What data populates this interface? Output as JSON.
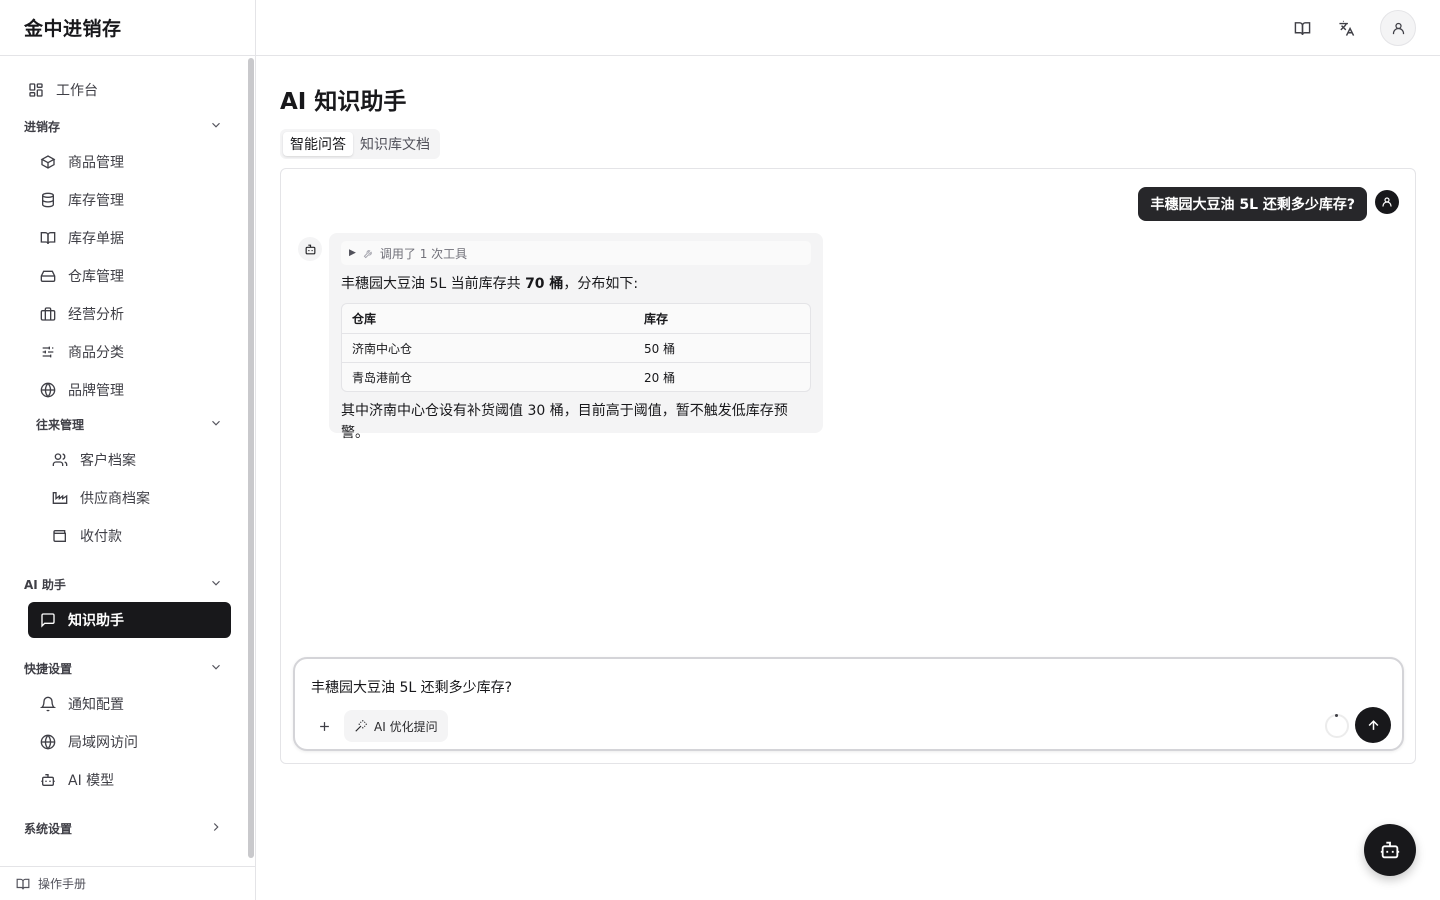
{
  "app": {
    "title": "金中进销存"
  },
  "sidebar": {
    "workbench": "工作台",
    "groups": {
      "jxc": "进销存",
      "partners": "往来管理",
      "ai": "AI 助手",
      "quick": "快捷设置",
      "system": "系统设置"
    },
    "jxc_items": [
      {
        "label": "商品管理",
        "icon": "box-icon"
      },
      {
        "label": "库存管理",
        "icon": "database-icon"
      },
      {
        "label": "库存单据",
        "icon": "book-open-icon"
      },
      {
        "label": "仓库管理",
        "icon": "warehouse-icon"
      },
      {
        "label": "经营分析",
        "icon": "briefcase-icon"
      },
      {
        "label": "商品分类",
        "icon": "sliders-icon"
      },
      {
        "label": "品牌管理",
        "icon": "globe-icon"
      }
    ],
    "partner_items": [
      {
        "label": "客户档案",
        "icon": "users-icon"
      },
      {
        "label": "供应商档案",
        "icon": "factory-icon"
      },
      {
        "label": "收付款",
        "icon": "wallet-icon"
      }
    ],
    "ai_items": [
      {
        "label": "知识助手",
        "icon": "message-square-icon",
        "active": true
      }
    ],
    "quick_items": [
      {
        "label": "通知配置",
        "icon": "bell-icon"
      },
      {
        "label": "局域网访问",
        "icon": "globe-icon"
      },
      {
        "label": "AI 模型",
        "icon": "bot-icon"
      }
    ],
    "footer": "操作手册"
  },
  "topbar": {
    "icons": [
      "book-open-icon",
      "languages-icon",
      "user-icon"
    ]
  },
  "main": {
    "title": "AI 知识助手",
    "tabs": [
      {
        "label": "智能问答",
        "active": true
      },
      {
        "label": "知识库文档",
        "active": false
      }
    ],
    "chat": {
      "user_message": "丰穗园大豆油 5L 还剩多少库存?",
      "tool_call": "调用了 1 次工具",
      "answer_prefix": "丰穗园大豆油 5L 当前库存共 ",
      "answer_bold": "70 桶",
      "answer_suffix": "，分布如下:",
      "table": {
        "headers": [
          "仓库",
          "库存"
        ],
        "rows": [
          [
            "济南中心仓",
            "50 桶"
          ],
          [
            "青岛港前仓",
            "20 桶"
          ]
        ]
      },
      "answer_note": "其中济南中心仓设有补货阈值 30 桶，目前高于阈值，暂不触发低库存预警。"
    },
    "composer": {
      "value": "丰穗园大豆油 5L 还剩多少库存?",
      "optimize_label": "AI 优化提问"
    }
  },
  "colors": {
    "primary": "#18181b",
    "border": "#e4e4e7",
    "muted_bg": "#f4f4f5"
  }
}
